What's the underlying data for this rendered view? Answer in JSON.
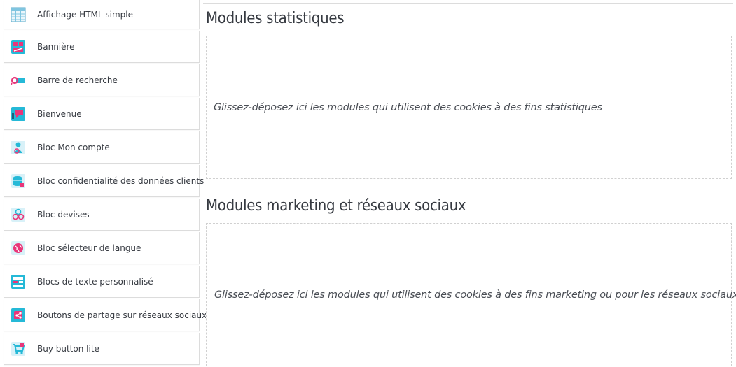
{
  "modules": [
    {
      "label": "Affichage HTML simple",
      "icon": "html-table-icon"
    },
    {
      "label": "Bannière",
      "icon": "banner-icon"
    },
    {
      "label": "Barre de recherche",
      "icon": "search-bar-icon"
    },
    {
      "label": "Bienvenue",
      "icon": "welcome-icon"
    },
    {
      "label": "Bloc Mon compte",
      "icon": "account-icon"
    },
    {
      "label": "Bloc confidentialité des données clients",
      "icon": "data-privacy-icon"
    },
    {
      "label": "Bloc devises",
      "icon": "currency-icon"
    },
    {
      "label": "Bloc sélecteur de langue",
      "icon": "language-selector-icon"
    },
    {
      "label": "Blocs de texte personnalisé",
      "icon": "custom-text-icon"
    },
    {
      "label": "Boutons de partage sur réseaux sociaux",
      "icon": "social-share-icon"
    },
    {
      "label": "Buy button lite",
      "icon": "cart-icon"
    }
  ],
  "zones": {
    "statistics": {
      "title": "Modules statistiques",
      "placeholder": "Glissez-déposez ici les modules qui utilisent des cookies à des fins statistiques"
    },
    "marketing": {
      "title": "Modules marketing et réseaux sociaux",
      "placeholder": "Glissez-déposez ici les modules qui utilisent des cookies à des fins marketing ou pour les réseaux sociaux"
    }
  },
  "colors": {
    "accent_teal": "#25b9d7",
    "accent_pink": "#e9367a"
  }
}
